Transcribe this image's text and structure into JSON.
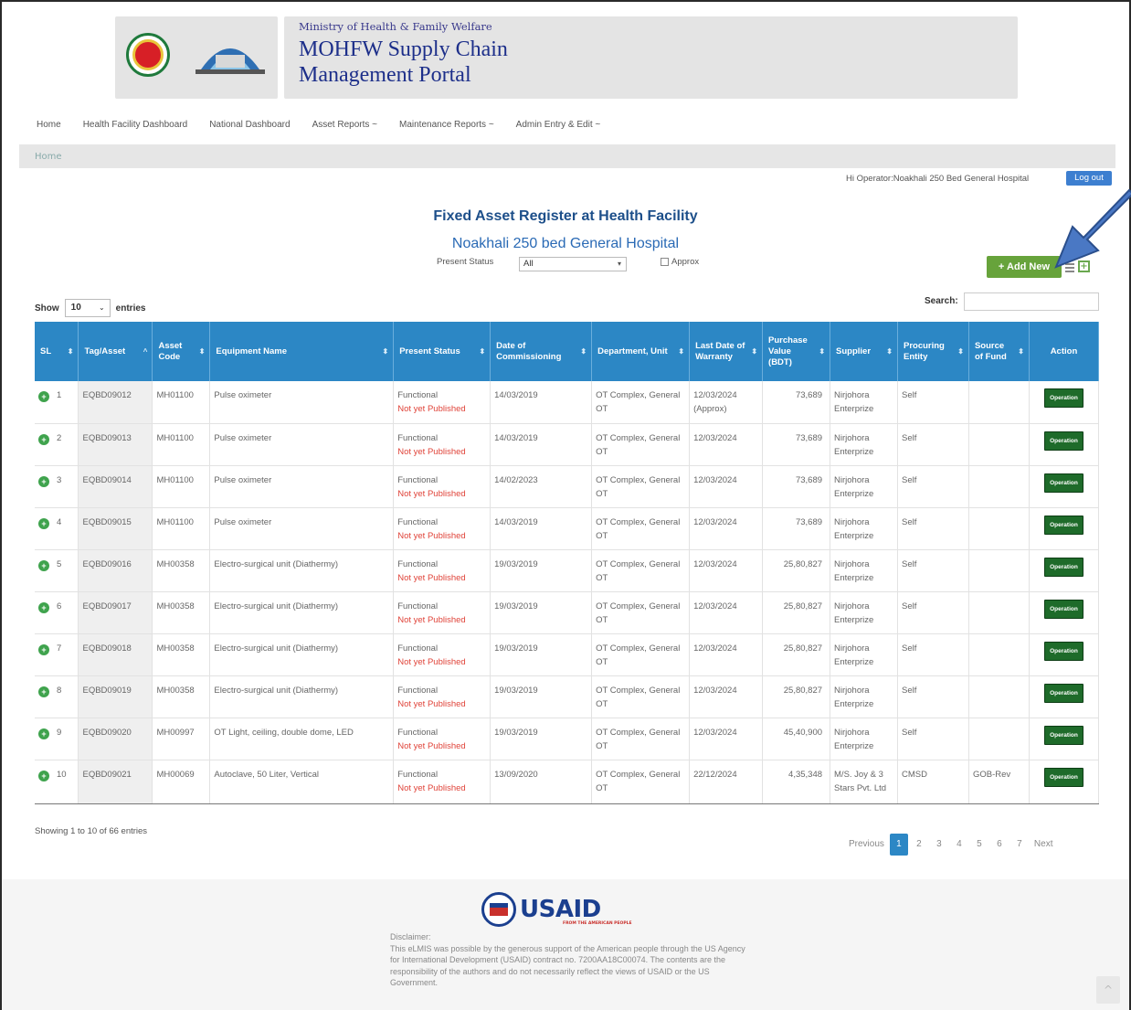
{
  "header": {
    "ministry": "Ministry of Health & Family Welfare",
    "portal_title": "MOHFW Supply Chain Management Portal"
  },
  "nav": [
    "Home",
    "Health Facility Dashboard",
    "National Dashboard",
    "Asset Reports ~",
    "Maintenance Reports ~",
    "Admin Entry & Edit ~"
  ],
  "breadcrumb": "Home",
  "user": {
    "greeting": "Hi Operator:Noakhali 250 Bed General Hospital",
    "logout_label": "Log out"
  },
  "page": {
    "heading": "Fixed Asset Register at Health Facility",
    "facility": "Noakhali 250 bed General Hospital"
  },
  "filters": {
    "present_status_label": "Present Status",
    "present_status_value": "All",
    "approx_label": "Approx"
  },
  "actions": {
    "add_new_label": "+ Add New"
  },
  "table_controls": {
    "show_label": "Show",
    "entries_value": "10",
    "entries_label": "entries",
    "search_label": "Search:"
  },
  "table": {
    "columns": [
      "SL",
      "Tag/Asset",
      "Asset Code",
      "Equipment Name",
      "Present Status",
      "Date of Commissioning",
      "Department, Unit",
      "Last Date of Warranty",
      "Purchase Value (BDT)",
      "Supplier",
      "Procuring Entity",
      "Source of Fund",
      "Action"
    ],
    "rows": [
      {
        "sl": "1",
        "tag": "EQBD09012",
        "code": "MH01100",
        "name": "Pulse oximeter",
        "status": "Functional",
        "publish": "Not yet Published",
        "date": "14/03/2019",
        "dept": "OT Complex, General OT",
        "warranty": "12/03/2024 (Approx)",
        "value": "73,689",
        "supplier": "Nirjohora Enterprize",
        "entity": "Self",
        "fund": "",
        "action": "Operation"
      },
      {
        "sl": "2",
        "tag": "EQBD09013",
        "code": "MH01100",
        "name": "Pulse oximeter",
        "status": "Functional",
        "publish": "Not yet Published",
        "date": "14/03/2019",
        "dept": "OT Complex, General OT",
        "warranty": "12/03/2024",
        "value": "73,689",
        "supplier": "Nirjohora Enterprize",
        "entity": "Self",
        "fund": "",
        "action": "Operation"
      },
      {
        "sl": "3",
        "tag": "EQBD09014",
        "code": "MH01100",
        "name": "Pulse oximeter",
        "status": "Functional",
        "publish": "Not yet Published",
        "date": "14/02/2023",
        "dept": "OT Complex, General OT",
        "warranty": "12/03/2024",
        "value": "73,689",
        "supplier": "Nirjohora Enterprize",
        "entity": "Self",
        "fund": "",
        "action": "Operation"
      },
      {
        "sl": "4",
        "tag": "EQBD09015",
        "code": "MH01100",
        "name": "Pulse oximeter",
        "status": "Functional",
        "publish": "Not yet Published",
        "date": "14/03/2019",
        "dept": "OT Complex, General OT",
        "warranty": "12/03/2024",
        "value": "73,689",
        "supplier": "Nirjohora Enterprize",
        "entity": "Self",
        "fund": "",
        "action": "Operation"
      },
      {
        "sl": "5",
        "tag": "EQBD09016",
        "code": "MH00358",
        "name": "Electro-surgical unit (Diathermy)",
        "status": "Functional",
        "publish": "Not yet Published",
        "date": "19/03/2019",
        "dept": "OT Complex, General OT",
        "warranty": "12/03/2024",
        "value": "25,80,827",
        "supplier": "Nirjohora Enterprize",
        "entity": "Self",
        "fund": "",
        "action": "Operation"
      },
      {
        "sl": "6",
        "tag": "EQBD09017",
        "code": "MH00358",
        "name": "Electro-surgical unit (Diathermy)",
        "status": "Functional",
        "publish": "Not yet Published",
        "date": "19/03/2019",
        "dept": "OT Complex, General OT",
        "warranty": "12/03/2024",
        "value": "25,80,827",
        "supplier": "Nirjohora Enterprize",
        "entity": "Self",
        "fund": "",
        "action": "Operation"
      },
      {
        "sl": "7",
        "tag": "EQBD09018",
        "code": "MH00358",
        "name": "Electro-surgical unit (Diathermy)",
        "status": "Functional",
        "publish": "Not yet Published",
        "date": "19/03/2019",
        "dept": "OT Complex, General OT",
        "warranty": "12/03/2024",
        "value": "25,80,827",
        "supplier": "Nirjohora Enterprize",
        "entity": "Self",
        "fund": "",
        "action": "Operation"
      },
      {
        "sl": "8",
        "tag": "EQBD09019",
        "code": "MH00358",
        "name": "Electro-surgical unit (Diathermy)",
        "status": "Functional",
        "publish": "Not yet Published",
        "date": "19/03/2019",
        "dept": "OT Complex, General OT",
        "warranty": "12/03/2024",
        "value": "25,80,827",
        "supplier": "Nirjohora Enterprize",
        "entity": "Self",
        "fund": "",
        "action": "Operation"
      },
      {
        "sl": "9",
        "tag": "EQBD09020",
        "code": "MH00997",
        "name": "OT Light, ceiling, double dome, LED",
        "status": "Functional",
        "publish": "Not yet Published",
        "date": "19/03/2019",
        "dept": "OT Complex, General OT",
        "warranty": "12/03/2024",
        "value": "45,40,900",
        "supplier": "Nirjohora Enterprize",
        "entity": "Self",
        "fund": "",
        "action": "Operation"
      },
      {
        "sl": "10",
        "tag": "EQBD09021",
        "code": "MH00069",
        "name": "Autoclave, 50 Liter, Vertical",
        "status": "Functional",
        "publish": "Not yet Published",
        "date": "13/09/2020",
        "dept": "OT Complex, General OT",
        "warranty": "22/12/2024",
        "value": "4,35,348",
        "supplier": "M/S. Joy & 3 Stars Pvt. Ltd",
        "entity": "CMSD",
        "fund": "GOB-Rev",
        "action": "Operation"
      }
    ]
  },
  "info": "Showing 1 to 10 of 66 entries",
  "pagination": [
    "Previous",
    "1",
    "2",
    "3",
    "4",
    "5",
    "6",
    "7",
    "Next"
  ],
  "footer": {
    "usaid": "USAID",
    "usaid_sub": "FROM THE AMERICAN PEOPLE",
    "disclaimer_title": "Disclaimer:",
    "disclaimer_text": "This eLMIS was possible by the generous support of the American people through the US Agency for International Development (USAID) contract no. 7200AA18C00074. The contents are the responsibility of the authors and do not necessarily reflect the views of USAID or the US Government."
  },
  "colors": {
    "table_header": "#2c87c5",
    "add_new": "#67a33b",
    "operation_button": "#1e6b2a",
    "status_red": "#e0443a",
    "title_blue": "#1d4f8a"
  }
}
